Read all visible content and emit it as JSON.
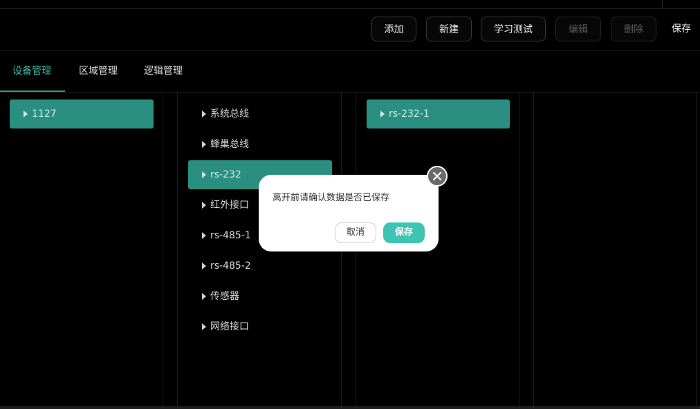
{
  "toolbar": {
    "add_label": "添加",
    "new_label": "新建",
    "learn_test_label": "学习测试",
    "edit_label": "编辑",
    "delete_label": "删除",
    "save_label": "保存"
  },
  "tabs": [
    {
      "label": "设备管理",
      "active": true
    },
    {
      "label": "区域管理",
      "active": false
    },
    {
      "label": "逻辑管理",
      "active": false
    }
  ],
  "device_column": {
    "items": [
      {
        "label": "1127",
        "selected": true
      }
    ]
  },
  "interface_column": {
    "items": [
      {
        "label": "系统总线",
        "selected": false
      },
      {
        "label": "蜂巢总线",
        "selected": false
      },
      {
        "label": "rs-232",
        "selected": true
      },
      {
        "label": "红外接口",
        "selected": false
      },
      {
        "label": "rs-485-1",
        "selected": false
      },
      {
        "label": "rs-485-2",
        "selected": false
      },
      {
        "label": "传感器",
        "selected": false
      },
      {
        "label": "网络接口",
        "selected": false
      }
    ]
  },
  "port_column": {
    "items": [
      {
        "label": "rs-232-1",
        "selected": true
      }
    ]
  },
  "dialog": {
    "message": "离开前请确认数据是否已保存",
    "cancel_label": "取消",
    "save_label": "保存",
    "close_icon": "close-icon"
  },
  "colors": {
    "accent": "#3fb7a5",
    "selected_bg": "#2a8f80",
    "dialog_save": "#3dc4b2"
  }
}
